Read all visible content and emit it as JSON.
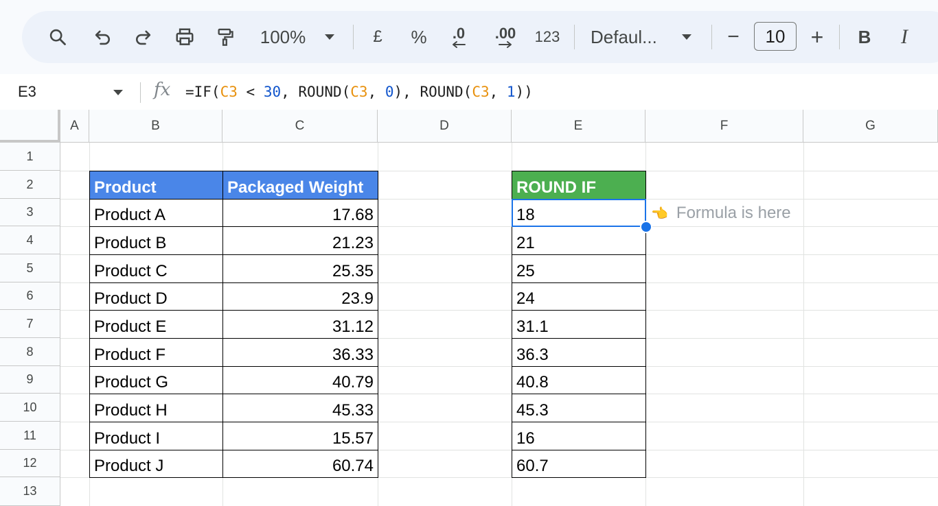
{
  "toolbar": {
    "zoom": "100%",
    "currency": "£",
    "percent": "%",
    "decrease_decimal": ".0",
    "increase_decimal": ".00",
    "number_format": "123",
    "font": "Defaul...",
    "font_size": "10",
    "minus": "−",
    "plus": "+",
    "bold": "B",
    "italic": "I"
  },
  "formula_bar": {
    "cell_ref": "E3",
    "fx": "fx",
    "formula_parts": {
      "p1": "=IF(",
      "p2": "C3",
      "p3": " < ",
      "p4": "30",
      "p5": ", ROUND(",
      "p6": "C3",
      "p7": ", ",
      "p8": "0",
      "p9": "), ROUND(",
      "p10": "C3",
      "p11": ", ",
      "p12": "1",
      "p13": "))"
    }
  },
  "columns": [
    "A",
    "B",
    "C",
    "D",
    "E",
    "F",
    "G"
  ],
  "rows": [
    "1",
    "2",
    "3",
    "4",
    "5",
    "6",
    "7",
    "8",
    "9",
    "10",
    "11",
    "12",
    "13"
  ],
  "table": {
    "header_product": "Product",
    "header_weight": "Packaged Weight",
    "header_round": "ROUND IF",
    "products": [
      "Product A",
      "Product B",
      "Product C",
      "Product D",
      "Product E",
      "Product F",
      "Product G",
      "Product H",
      "Product I",
      "Product J"
    ],
    "weights": [
      "17.68",
      "21.23",
      "25.35",
      "23.9",
      "31.12",
      "36.33",
      "40.79",
      "45.33",
      "15.57",
      "60.74"
    ],
    "rounded": [
      "18",
      "21",
      "25",
      "24",
      "31.1",
      "36.3",
      "40.8",
      "45.3",
      "16",
      "60.7"
    ]
  },
  "annotation": {
    "icon": "👈",
    "text": "Formula is here"
  },
  "colors": {
    "header_blue": "#4a86e8",
    "header_green": "#4caf50",
    "selection": "#1a73e8"
  }
}
